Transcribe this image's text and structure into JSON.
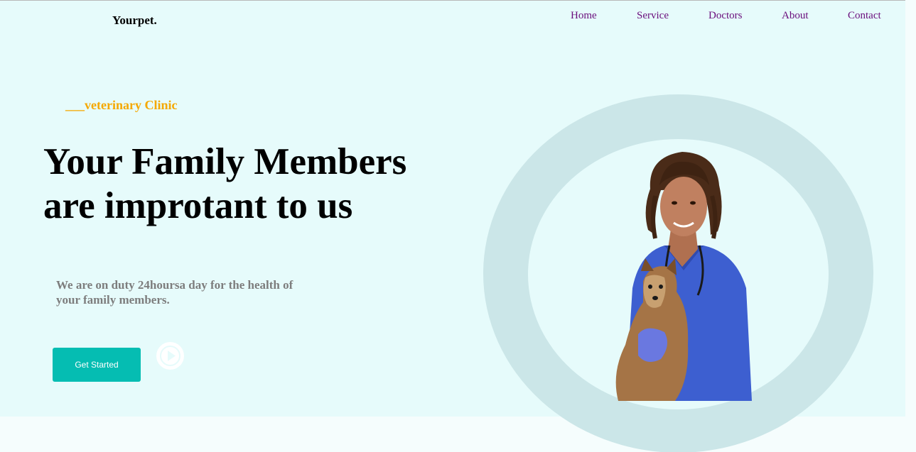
{
  "header": {
    "brand": "Yourpet.",
    "nav": [
      "Home",
      "Service",
      "Doctors",
      "About",
      "Contact"
    ]
  },
  "hero": {
    "tagline": "___veterinary Clinic",
    "headline_line1": "Your Family Members",
    "headline_line2": "are improtant to us",
    "description": "We are on duty 24hoursa day for the health of your family members.",
    "cta_label": "Get Started",
    "play_icon": "play-icon",
    "image_subject": "vet-with-dog"
  },
  "colors": {
    "accent": "#05bdb2",
    "tagline": "#f5a800",
    "nav_link": "#6a0d7c",
    "hero_bg": "#e6fbfb",
    "ring": "#cbe6e8"
  }
}
